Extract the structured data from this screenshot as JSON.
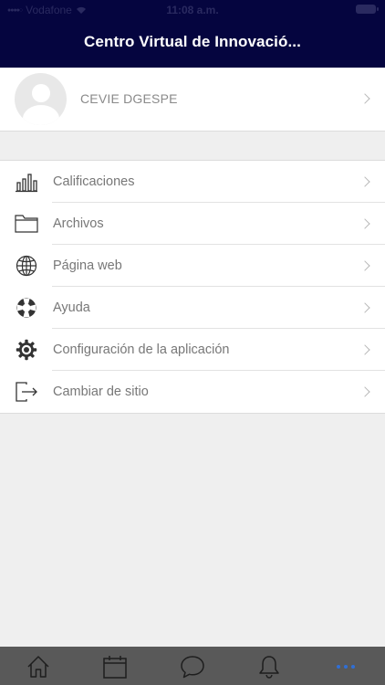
{
  "status_bar": {
    "carrier": "Vodafone",
    "time": "11:08 a.m."
  },
  "header": {
    "title": "Centro Virtual de Innovació..."
  },
  "profile": {
    "name": "CEVIE DGESPE"
  },
  "menu": {
    "items": [
      {
        "label": "Calificaciones",
        "icon": "bar-chart-icon"
      },
      {
        "label": "Archivos",
        "icon": "folder-icon"
      },
      {
        "label": "Página web",
        "icon": "globe-icon"
      },
      {
        "label": "Ayuda",
        "icon": "lifebuoy-icon"
      },
      {
        "label": "Configuración de la aplicación",
        "icon": "gear-icon"
      },
      {
        "label": "Cambiar de sitio",
        "icon": "exit-icon"
      }
    ]
  },
  "tabbar": {
    "tabs": [
      {
        "icon": "home-icon"
      },
      {
        "icon": "calendar-icon"
      },
      {
        "icon": "chat-icon"
      },
      {
        "icon": "bell-icon"
      },
      {
        "icon": "more-icon"
      }
    ],
    "active_color": "#2f6fd6",
    "icon_color": "#1e1e1e"
  },
  "colors": {
    "header": "#05053f",
    "background": "#efefef"
  }
}
